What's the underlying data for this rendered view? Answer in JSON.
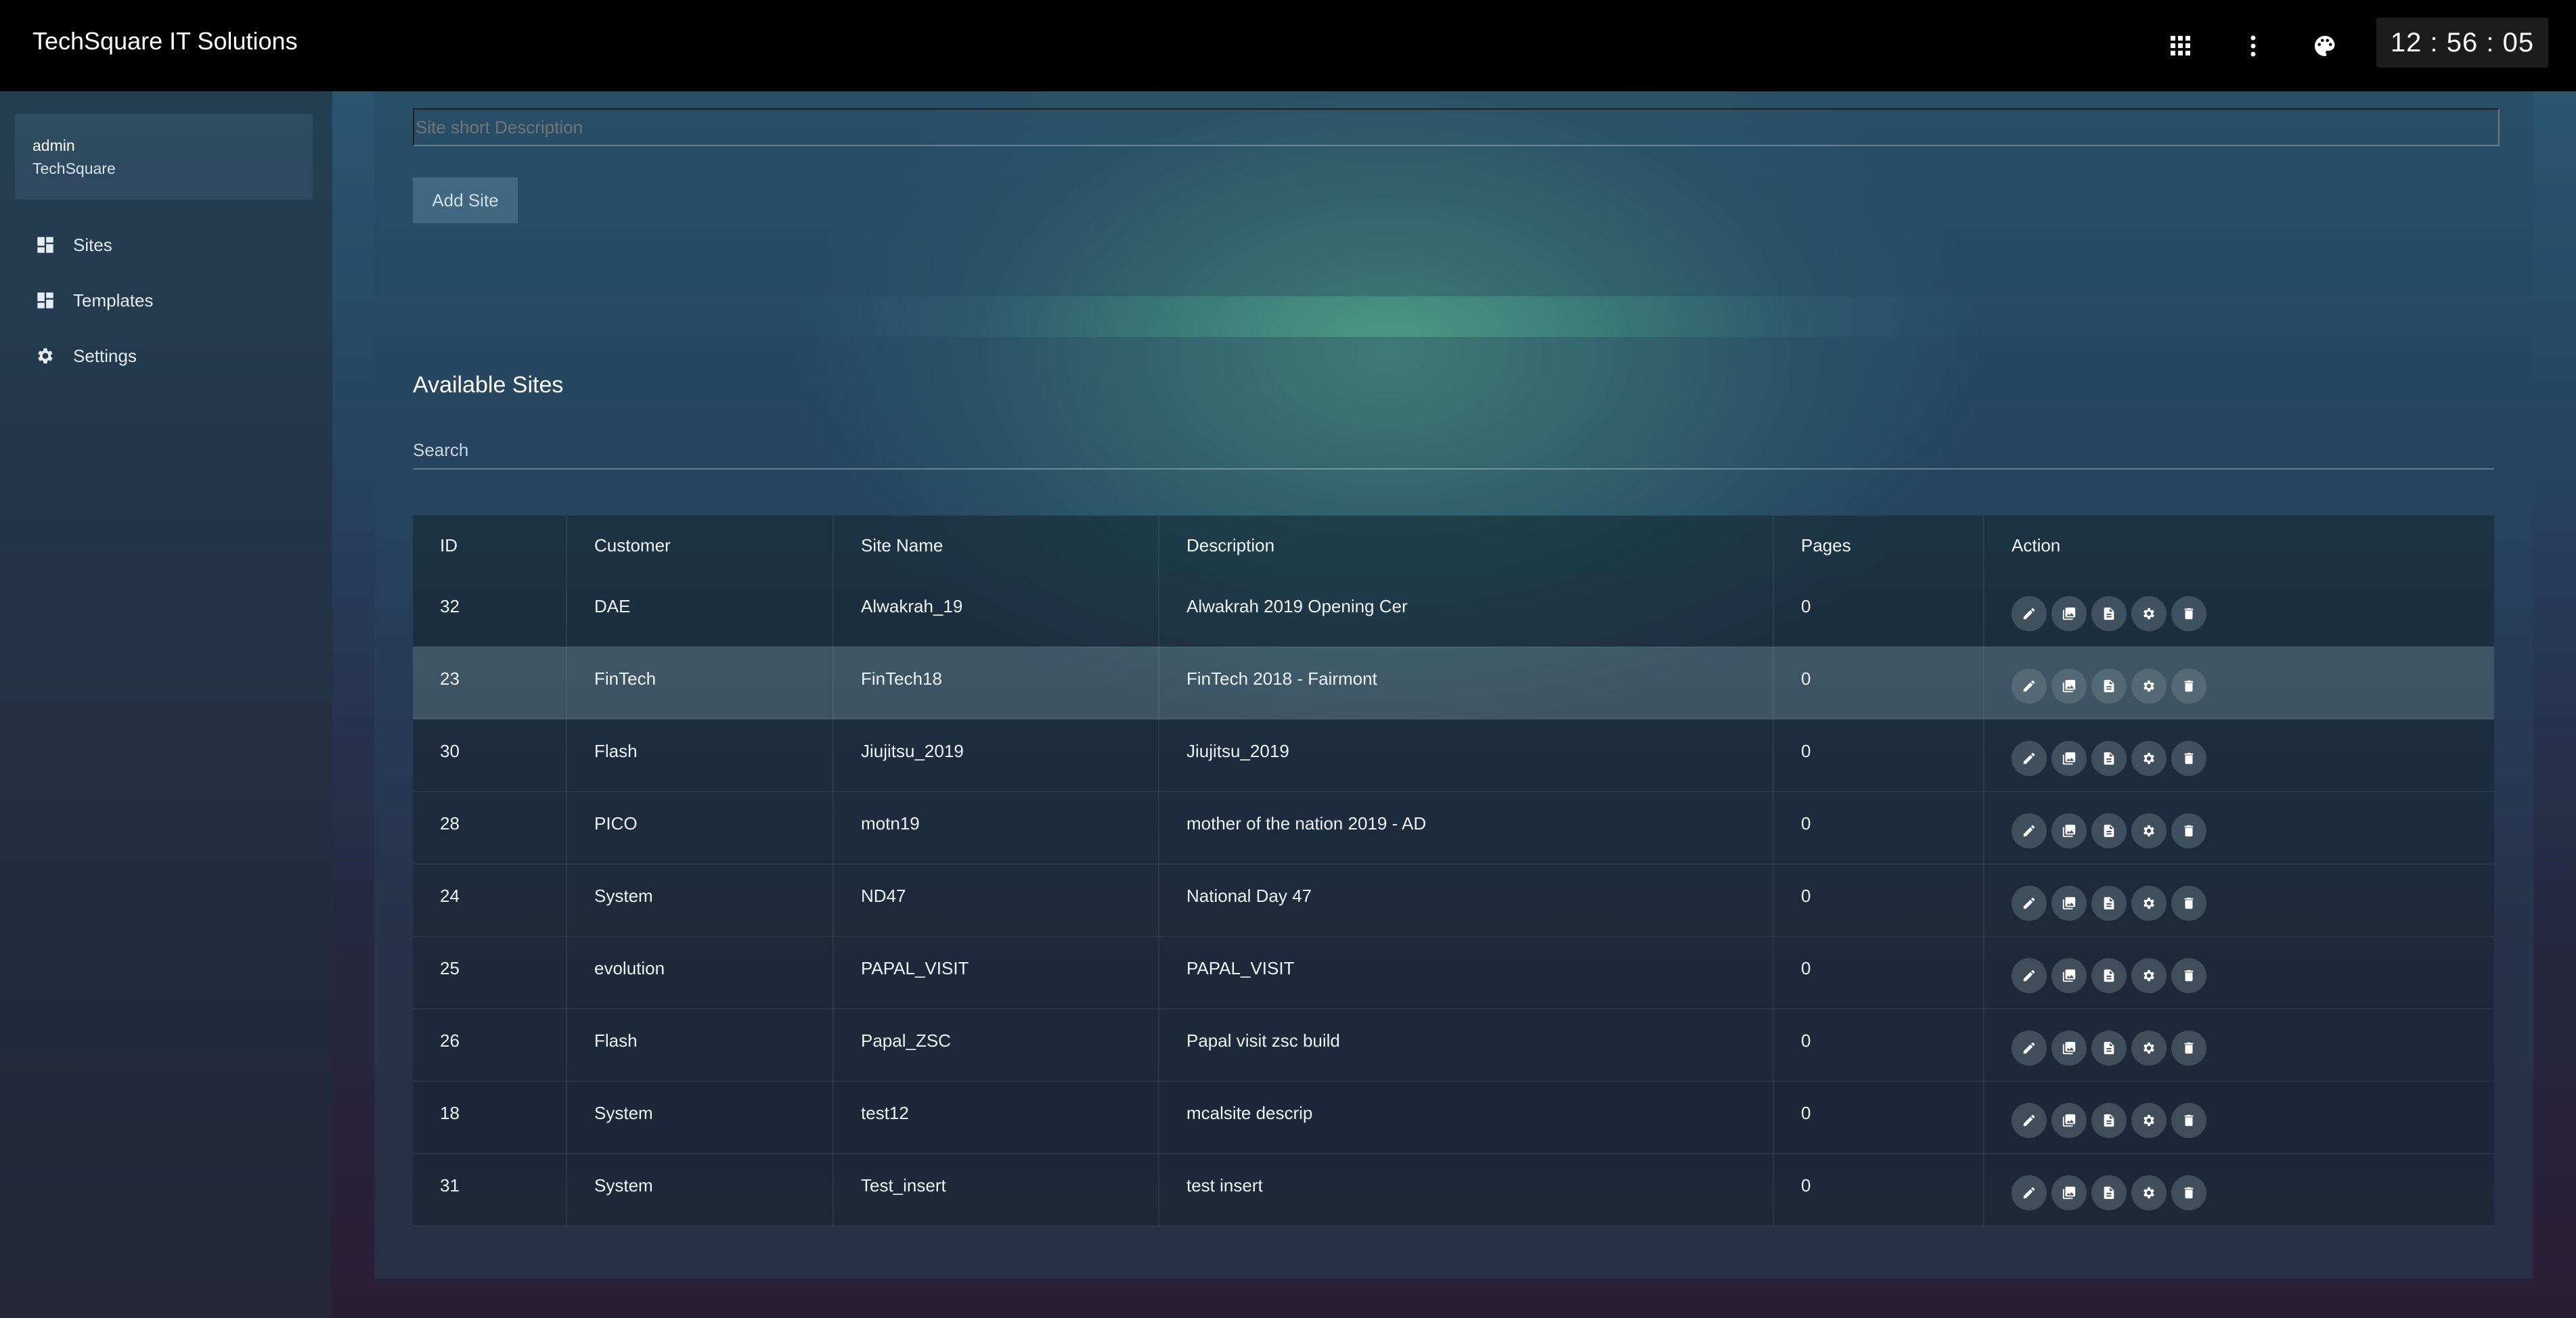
{
  "header": {
    "brand": "TechSquare IT Solutions",
    "clock": "12 : 56 : 05",
    "icons": [
      "apps-grid-icon",
      "more-vertical-icon",
      "palette-icon"
    ]
  },
  "sidebar": {
    "user": {
      "name": "admin",
      "org": "TechSquare"
    },
    "items": [
      {
        "label": "Sites",
        "icon": "dashboard-icon"
      },
      {
        "label": "Templates",
        "icon": "dashboard-icon"
      },
      {
        "label": "Settings",
        "icon": "gear-icon"
      }
    ]
  },
  "add_site": {
    "short_desc_placeholder": "Site short Description",
    "button_label": "Add Site"
  },
  "sites": {
    "title": "Available Sites",
    "search_placeholder": "Search",
    "columns": [
      "ID",
      "Customer",
      "Site Name",
      "Description",
      "Pages",
      "Action"
    ],
    "action_icons": [
      "edit-icon",
      "gallery-icon",
      "document-icon",
      "settings-icon",
      "delete-icon"
    ],
    "rows": [
      {
        "id": "32",
        "customer": "DAE",
        "site_name": "Alwakrah_19",
        "description": "Alwakrah 2019 Opening Cer",
        "pages": "0"
      },
      {
        "id": "23",
        "customer": "FinTech",
        "site_name": "FinTech18",
        "description": "FinTech 2018 - Fairmont",
        "pages": "0"
      },
      {
        "id": "30",
        "customer": "Flash",
        "site_name": "Jiujitsu_2019",
        "description": "Jiujitsu_2019",
        "pages": "0"
      },
      {
        "id": "28",
        "customer": "PICO",
        "site_name": "motn19",
        "description": "mother of the nation 2019 - AD",
        "pages": "0"
      },
      {
        "id": "24",
        "customer": "System",
        "site_name": "ND47",
        "description": "National Day 47",
        "pages": "0"
      },
      {
        "id": "25",
        "customer": "evolution",
        "site_name": "PAPAL_VISIT",
        "description": "PAPAL_VISIT",
        "pages": "0"
      },
      {
        "id": "26",
        "customer": "Flash",
        "site_name": "Papal_ZSC",
        "description": "Papal visit zsc build",
        "pages": "0"
      },
      {
        "id": "18",
        "customer": "System",
        "site_name": "test12",
        "description": "mcalsite descrip",
        "pages": "0"
      },
      {
        "id": "31",
        "customer": "System",
        "site_name": "Test_insert",
        "description": "test insert",
        "pages": "0"
      }
    ]
  },
  "colors": {
    "topbar": "#000000",
    "row_highlight": "#5a7378"
  }
}
